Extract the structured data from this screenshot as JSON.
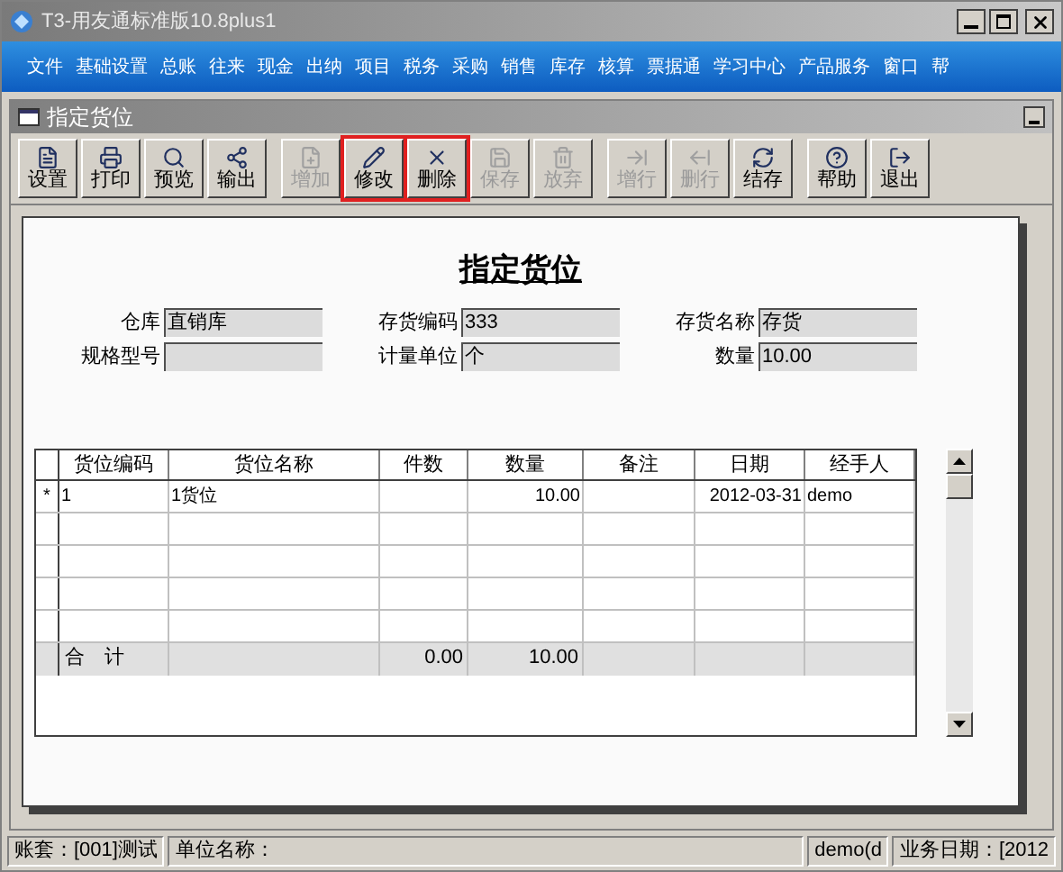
{
  "window": {
    "title": "T3-用友通标准版10.8plus1"
  },
  "menu": [
    "文件",
    "基础设置",
    "总账",
    "往来",
    "现金",
    "出纳",
    "项目",
    "税务",
    "采购",
    "销售",
    "库存",
    "核算",
    "票据通",
    "学习中心",
    "产品服务",
    "窗口",
    "帮"
  ],
  "child_window": {
    "title": "指定货位"
  },
  "toolbar": [
    [
      {
        "label": "设置",
        "disabled": false,
        "highlighted": false
      },
      {
        "label": "打印",
        "disabled": false,
        "highlighted": false
      },
      {
        "label": "预览",
        "disabled": false,
        "highlighted": false
      },
      {
        "label": "输出",
        "disabled": false,
        "highlighted": false
      }
    ],
    [
      {
        "label": "增加",
        "disabled": true,
        "highlighted": false
      },
      {
        "label": "修改",
        "disabled": false,
        "highlighted": true
      },
      {
        "label": "删除",
        "disabled": false,
        "highlighted": true
      },
      {
        "label": "保存",
        "disabled": true,
        "highlighted": false
      },
      {
        "label": "放弃",
        "disabled": true,
        "highlighted": false
      }
    ],
    [
      {
        "label": "增行",
        "disabled": true,
        "highlighted": false
      },
      {
        "label": "删行",
        "disabled": true,
        "highlighted": false
      },
      {
        "label": "结存",
        "disabled": false,
        "highlighted": false
      }
    ],
    [
      {
        "label": "帮助",
        "disabled": false,
        "highlighted": false
      },
      {
        "label": "退出",
        "disabled": false,
        "highlighted": false
      }
    ]
  ],
  "form": {
    "title": "指定货位",
    "fields": [
      [
        {
          "label": "仓库",
          "value": "直销库"
        },
        {
          "label": "存货编码",
          "value": "333"
        },
        {
          "label": "存货名称",
          "value": "存货"
        }
      ],
      [
        {
          "label": "规格型号"
        },
        {
          "label": "计量单位",
          "value": "个"
        },
        {
          "label": "数量",
          "value": "10.00"
        }
      ]
    ]
  },
  "table": {
    "columns": [
      "货位编码",
      "货位名称",
      "件数",
      "数量",
      "备注",
      "日期",
      "经手人"
    ],
    "rows": [
      {
        "marker": "*",
        "cells": [
          "1",
          "1货位",
          "",
          "10.00",
          "",
          "2012-03-31",
          "demo"
        ]
      },
      {
        "marker": "",
        "cells": [
          "",
          "",
          "",
          "",
          "",
          "",
          ""
        ]
      },
      {
        "marker": "",
        "cells": [
          "",
          "",
          "",
          "",
          "",
          "",
          ""
        ]
      },
      {
        "marker": "",
        "cells": [
          "",
          "",
          "",
          "",
          "",
          "",
          ""
        ]
      },
      {
        "marker": "",
        "cells": [
          "",
          "",
          "",
          "",
          "",
          "",
          ""
        ]
      }
    ],
    "total": {
      "label": "合　计",
      "cells": [
        "",
        "",
        "0.00",
        "10.00",
        "",
        "",
        ""
      ]
    }
  },
  "status_bar": [
    "账套：[001]测试",
    "单位名称：",
    "demo(d",
    "业务日期：[2012"
  ]
}
